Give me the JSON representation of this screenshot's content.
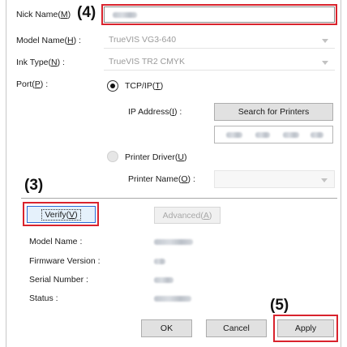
{
  "fields": {
    "nick_name_label": "Nick Name(",
    "nick_name_key": "M",
    "nick_name_close": ")",
    "model_name_label": "Model Name(",
    "model_name_key": "H",
    "model_name_close": ") :",
    "model_name_value": "TrueVIS VG3-640",
    "ink_type_label": "Ink Type(",
    "ink_type_key": "N",
    "ink_type_close": ") :",
    "ink_type_value": "TrueVIS TR2 CMYK",
    "port_label": "Port(",
    "port_key": "P",
    "port_close": ") :"
  },
  "port": {
    "tcpip_label": "TCP/IP(",
    "tcpip_key": "T",
    "tcpip_close": ")",
    "ip_address_label": "IP Address(",
    "ip_address_key": "I",
    "ip_address_close": ") :",
    "search_button": "Search for Printers",
    "printer_driver_label": "Printer Driver(",
    "printer_driver_key": "U",
    "printer_driver_close": ")",
    "printer_name_label": "Printer Name(",
    "printer_name_key": "O",
    "printer_name_close": ") :"
  },
  "verify": {
    "verify_label": "Verify(",
    "verify_key": "V",
    "verify_close": ")",
    "advanced_label": "Advanced(",
    "advanced_key": "A",
    "advanced_close": ")"
  },
  "info": {
    "model_name": "Model Name :",
    "firmware_version": "Firmware Version :",
    "serial_number": "Serial Number :",
    "status": "Status :"
  },
  "footer": {
    "ok": "OK",
    "cancel": "Cancel",
    "apply": "Apply"
  },
  "callouts": {
    "c3": "(3)",
    "c4": "(4)",
    "c5": "(5)"
  },
  "colors": {
    "highlight_red": "#d9232d",
    "verify_focus_blue": "#2b6cd6"
  }
}
